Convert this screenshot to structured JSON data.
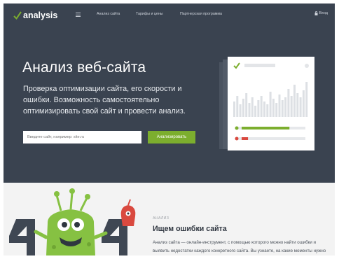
{
  "nav": {
    "logo_text": "analysis",
    "menu_icon": "hamburger-icon",
    "links": [
      "Анализ сайта",
      "Тарифы и цены",
      "Партнерская программа"
    ],
    "login_label": "Вход",
    "login_icon": "lock-icon"
  },
  "hero": {
    "title": "Анализ веб-сайта",
    "subtitle": "Проверка оптимизации сайта, его скорости и ошибки. Возможность самостоятельно оптимизировать свой сайт и провести анализ.",
    "search": {
      "placeholder": "Введите сайт, например: site.ru",
      "value": ""
    },
    "button_label": "Анализировать"
  },
  "illustration": {
    "progress_green": 0.75,
    "progress_red": 0.1
  },
  "section": {
    "label": "АНАЛИЗ",
    "title": "Ищем ошибки сайта",
    "text": "Анализ сайта — онлайн-инструмент, с помощью которого можно найти ошибки и выявить недостатки каждого конкретного сайта. Вы узнаете, на какие моменты нужно обратить особенно пристальное внимание, и",
    "graphic_text": "404"
  },
  "colors": {
    "hero_bg": "#3a4350",
    "accent_green": "#7cae2e",
    "error_red": "#d9493f",
    "section_bg": "#f3f3f3",
    "monster_green": "#86c142"
  }
}
